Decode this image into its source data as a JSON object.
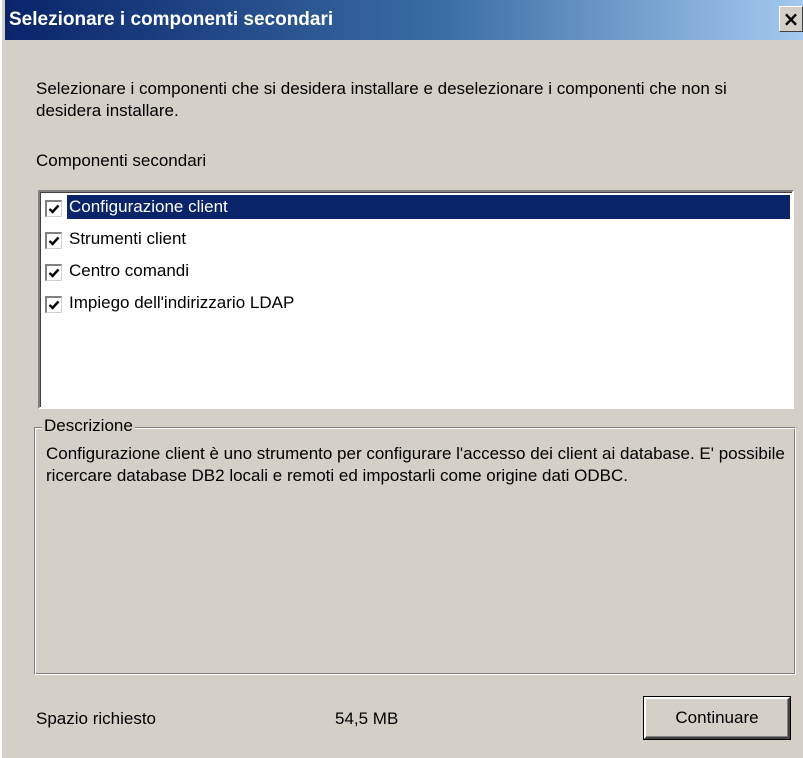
{
  "window": {
    "title": "Selezionare i componenti secondari",
    "close_glyph": "×"
  },
  "instructions": "Selezionare i componenti che si desidera installare e deselezionare i componenti che non si desidera installare.",
  "components": {
    "label": "Componenti secondari",
    "items": [
      {
        "label": "Configurazione client",
        "checked": true,
        "selected": true
      },
      {
        "label": "Strumenti client",
        "checked": true,
        "selected": false
      },
      {
        "label": "Centro comandi",
        "checked": true,
        "selected": false
      },
      {
        "label": "Impiego dell'indirizzario LDAP",
        "checked": true,
        "selected": false
      }
    ]
  },
  "description": {
    "legend": "Descrizione",
    "text": "Configurazione client è uno strumento per configurare l'accesso dei client ai database. E' possibile ricercare database DB2 locali e remoti ed impostarli come origine dati ODBC."
  },
  "footer": {
    "space_label": "Spazio richiesto",
    "space_value": "54,5 MB",
    "continue_label": "Continuare"
  },
  "colors": {
    "title_bar_start": "#0a246a",
    "title_bar_end": "#a6caf0",
    "dialog_face": "#d4d0c8",
    "selection": "#0a246a"
  },
  "icons": {
    "close": "close-icon",
    "check": "checkmark-icon"
  }
}
